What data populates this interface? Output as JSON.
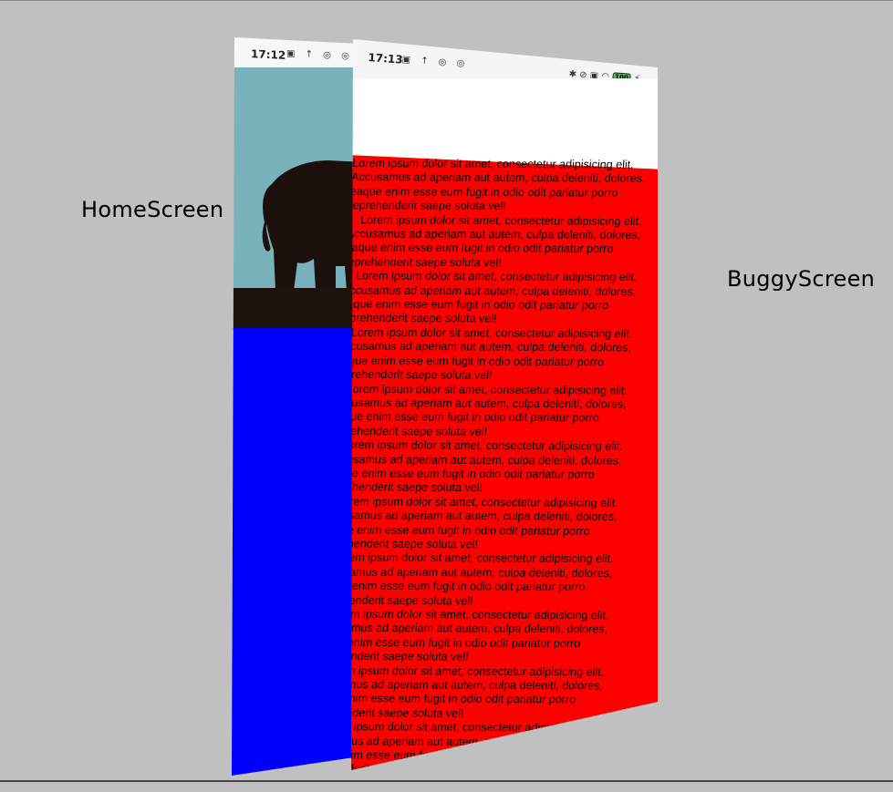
{
  "labels": {
    "home": "HomeScreen",
    "buggy": "BuggyScreen"
  },
  "home_screen": {
    "time": "17:12",
    "status_icons": "▣ ↑ ◎ ◎",
    "image_colors": {
      "sky": "#79b2bb",
      "ground": "#1e120e",
      "elephant": "#1b100c"
    },
    "body_color": "#0000ff"
  },
  "buggy_screen": {
    "time": "17:13",
    "left_status_icons": "▣ ↑ ◎ ◎",
    "right_status_icons": "✱ ⊘ ▣ ◠",
    "battery": "100",
    "header_color": "#ffffff",
    "body_color": "#ff0000",
    "paragraphs": [
      "Lorem ipsum dolor sit amet, consectetur adipisicing elit. Accusamus ad aperiam aut autem, culpa deleniti, dolores, eaque enim esse eum fugit in odio odit pariatur porro reprehenderit saepe soluta vel!",
      "Lorem ipsum dolor sit amet, consectetur adipisicing elit. Accusamus ad aperiam aut autem, culpa deleniti, dolores, eaque enim esse eum fugit in odio odit pariatur porro reprehenderit saepe soluta vel!",
      "Lorem ipsum dolor sit amet, consectetur adipisicing elit. Accusamus ad aperiam aut autem, culpa deleniti, dolores, eaque enim esse eum fugit in odio odit pariatur porro reprehenderit saepe soluta vel!",
      "Lorem ipsum dolor sit amet, consectetur adipisicing elit. Accusamus ad aperiam aut autem, culpa deleniti, dolores, eaque enim esse eum fugit in odio odit pariatur porro reprehenderit saepe soluta vel!",
      "Lorem ipsum dolor sit amet, consectetur adipisicing elit. Accusamus ad aperiam aut autem, culpa deleniti, dolores, eaque enim esse eum fugit in odio odit pariatur porro reprehenderit saepe soluta vel!",
      "Lorem ipsum dolor sit amet, consectetur adipisicing elit. Accusamus ad aperiam aut autem, culpa deleniti, dolores, eaque enim esse eum fugit in odio odit pariatur porro reprehenderit saepe soluta vel!",
      "Lorem ipsum dolor sit amet, consectetur adipisicing elit. Accusamus ad aperiam aut autem, culpa deleniti, dolores, eaque enim esse eum fugit in odio odit pariatur porro reprehenderit saepe soluta vel!",
      "Lorem ipsum dolor sit amet, consectetur adipisicing elit. Accusamus ad aperiam aut autem, culpa deleniti, dolores, eaque enim esse eum fugit in odio odit pariatur porro reprehenderit saepe soluta vel!",
      "Lorem ipsum dolor sit amet, consectetur adipisicing elit. Accusamus ad aperiam aut autem, culpa deleniti, dolores, eaque enim esse eum fugit in odio odit pariatur porro reprehenderit saepe soluta vel!",
      "Lorem ipsum dolor sit amet, consectetur adipisicing elit. Accusamus ad aperiam aut autem, culpa deleniti, dolores, eaque enim esse eum fugit in odio odit pariatur porro reprehenderit saepe soluta vel!",
      "Lorem ipsum dolor sit amet, consectetur adipisicing elit. Accusamus ad aperiam aut autem, culpa deleniti, dolores, eaque enim esse eum fugit in odio odit pariatur porro reprehenderit saepe soluta vel!",
      "Lorem ipsum dolor sit amet, consectetur adipisicing elit."
    ]
  }
}
